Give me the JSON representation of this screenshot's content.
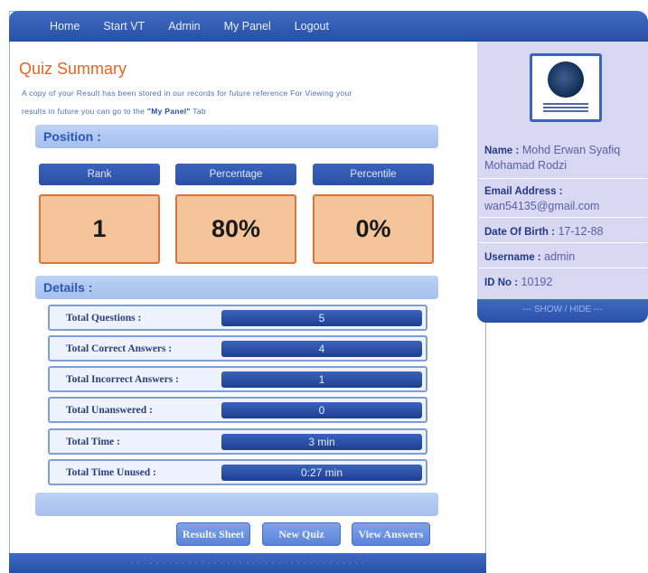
{
  "nav": {
    "items": [
      "Home",
      "Start VT",
      "Admin",
      "My Panel",
      "Logout"
    ]
  },
  "quiz": {
    "title": "Quiz Summary",
    "intro_line1": "A copy of your Result has been stored in our records for future reference For Viewing your",
    "intro_line2_prefix": "results in future you can go to the ",
    "intro_line2_link": "\"My Panel\"",
    "intro_line2_suffix": " Tab"
  },
  "position": {
    "section_label": "Position :",
    "stats": [
      {
        "label": "Rank",
        "value": "1"
      },
      {
        "label": "Percentage",
        "value": "80%"
      },
      {
        "label": "Percentile",
        "value": "0%"
      }
    ]
  },
  "details": {
    "section_label": "Details :",
    "rows": [
      {
        "label": "Total Questions :",
        "value": "5"
      },
      {
        "label": "Total Correct Answers :",
        "value": "4"
      },
      {
        "label": "Total Incorrect Answers :",
        "value": "1"
      },
      {
        "label": "Total Unanswered :",
        "value": "0"
      },
      {
        "label": "Total Time :",
        "value": "3 min"
      },
      {
        "label": "Total Time Unused :",
        "value": "0:27 min"
      }
    ]
  },
  "buttons": {
    "results_sheet": "Results Sheet",
    "new_quiz": "New Quiz",
    "view_answers": "View Answers"
  },
  "profile": {
    "name_label": "Name :",
    "name_value": "Mohd Erwan Syafiq Mohamad Rodzi",
    "email_label": "Email Address :",
    "email_value": "wan54135@gmail.com",
    "dob_label": "Date Of Birth :",
    "dob_value": "17-12-88",
    "username_label": "Username :",
    "username_value": "admin",
    "id_label": "ID No :",
    "id_value": "10192",
    "toggle": "--- SHOW / HIDE ---"
  },
  "colors": {
    "nav_blue": "#2f56ad",
    "title_orange": "#e8641f",
    "stat_fill": "#f4c49a",
    "stat_border": "#d8763c",
    "panel_lavender": "#d8d8f2"
  },
  "icons": {
    "university_logo": "university-logo-icon"
  }
}
